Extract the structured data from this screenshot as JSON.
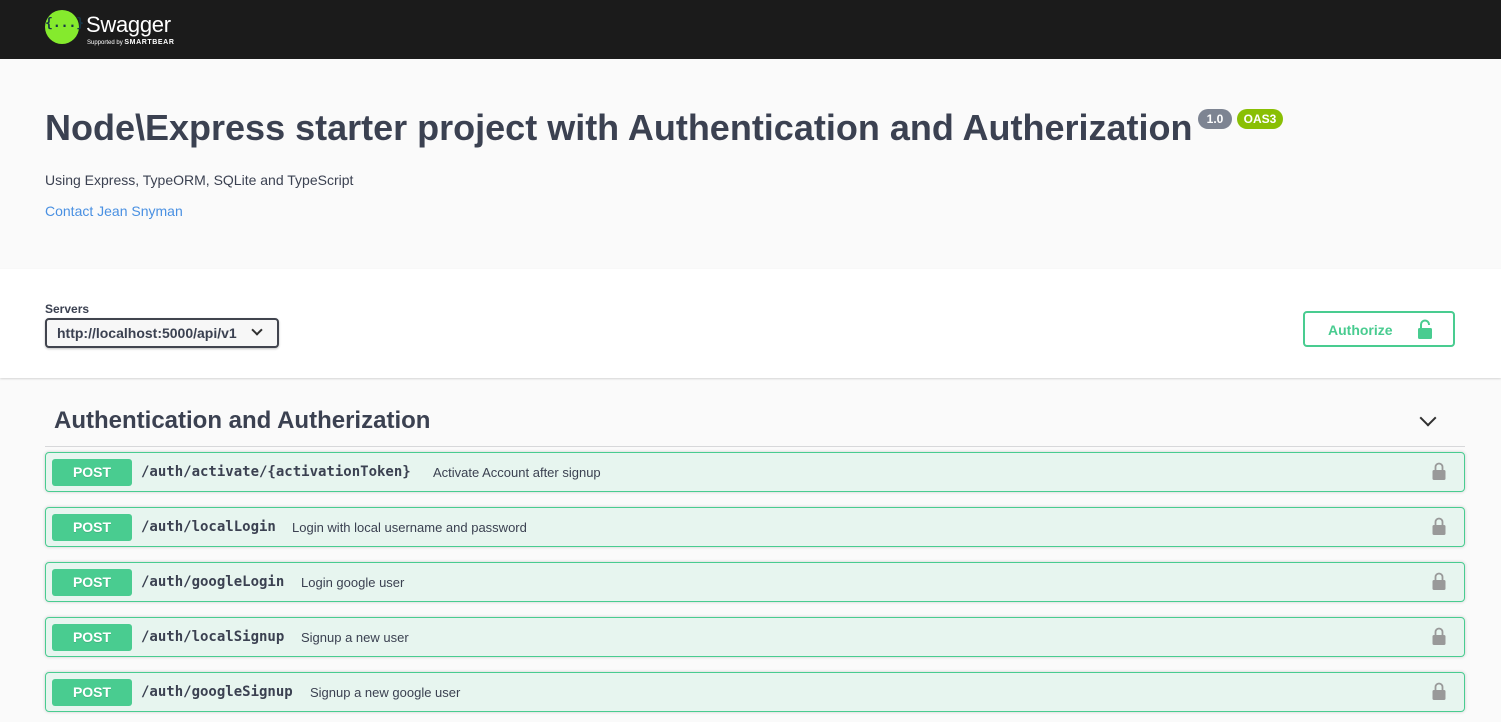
{
  "topbar": {
    "logo_glyph": "{...}",
    "brand": "Swagger",
    "supported_by": "Supported by",
    "sponsor": "SMARTBEAR"
  },
  "info": {
    "title": "Node\\Express starter project with Authentication and Autherization",
    "version": "1.0",
    "oas": "OAS3",
    "description": "Using Express, TypeORM, SQLite and TypeScript",
    "contact": "Contact Jean Snyman"
  },
  "servers": {
    "label": "Servers",
    "selected": "http://localhost:5000/api/v1"
  },
  "authorize": {
    "label": "Authorize",
    "icon": "unlocked-lock-icon"
  },
  "tag": {
    "title": "Authentication and Autherization",
    "expanded": true
  },
  "operations": [
    {
      "method": "POST",
      "path": "/auth/activate/{activationToken}",
      "summary": "Activate Account after signup"
    },
    {
      "method": "POST",
      "path": "/auth/localLogin",
      "summary": "Login with local username and password"
    },
    {
      "method": "POST",
      "path": "/auth/googleLogin",
      "summary": "Login google user"
    },
    {
      "method": "POST",
      "path": "/auth/localSignup",
      "summary": "Signup a new user"
    },
    {
      "method": "POST",
      "path": "/auth/googleSignup",
      "summary": "Signup a new google user"
    }
  ],
  "colors": {
    "topbar_bg": "#1b1b1b",
    "swagger_green": "#85ea2d",
    "post": "#49cc90",
    "link": "#4990e2",
    "version_badge": "#7d8492",
    "oas_badge": "#89bf04"
  }
}
